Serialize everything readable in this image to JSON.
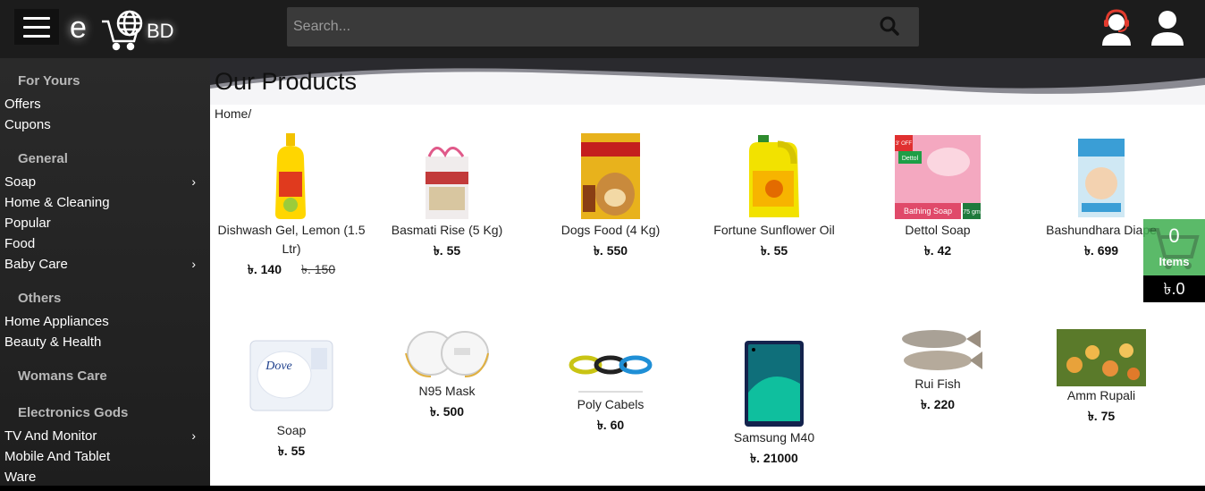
{
  "header": {
    "logo_letter": "e",
    "logo_suffix": "BD",
    "search_placeholder": "Search...",
    "icons": [
      "menu-icon",
      "search-icon",
      "support-icon",
      "user-icon"
    ]
  },
  "sidebar": {
    "sections": [
      {
        "title": "For Yours",
        "items": [
          {
            "label": "Offers",
            "chevron": false
          },
          {
            "label": "Cupons",
            "chevron": false
          }
        ]
      },
      {
        "title": "General",
        "items": [
          {
            "label": "Soap",
            "chevron": true
          },
          {
            "label": "Home & Cleaning",
            "chevron": false
          },
          {
            "label": "Popular",
            "chevron": false
          },
          {
            "label": "Food",
            "chevron": false
          },
          {
            "label": "Baby Care",
            "chevron": true
          }
        ]
      },
      {
        "title": "Others",
        "items": [
          {
            "label": "Home Appliances",
            "chevron": false
          },
          {
            "label": "Beauty & Health",
            "chevron": false
          }
        ]
      },
      {
        "title": "Womans Care",
        "items": []
      },
      {
        "title": "Electronics Gods",
        "items": [
          {
            "label": "TV And Monitor",
            "chevron": true
          },
          {
            "label": "Mobile And Tablet",
            "chevron": false
          },
          {
            "label": "Ware",
            "chevron": false
          }
        ]
      }
    ]
  },
  "main": {
    "title": "Our Products",
    "breadcrumb": "Home/"
  },
  "products": [
    {
      "name": "Dishwash Gel, Lemon (1.5 Ltr)",
      "price": "৳. 140",
      "old_price": "৳. 150"
    },
    {
      "name": "Basmati Rise (5 Kg)",
      "price": "৳. 55"
    },
    {
      "name": "Dogs Food (4 Kg)",
      "price": "৳. 550"
    },
    {
      "name": "Fortune Sunflower Oil",
      "price": "৳. 55"
    },
    {
      "name": "Dettol Soap",
      "price": "৳. 42",
      "image_text": [
        "3' OFF",
        "Dettol",
        "Bathing Soap",
        "75 gm"
      ]
    },
    {
      "name": "Bashundhara Diape",
      "price": "৳. 699"
    },
    {
      "name": "Soap",
      "price": "৳. 55",
      "image_text": [
        "Dove"
      ]
    },
    {
      "name": "N95 Mask",
      "price": "৳. 500"
    },
    {
      "name": "Poly Cabels",
      "price": "৳. 60"
    },
    {
      "name": "Samsung M40",
      "price": "৳. 21000"
    },
    {
      "name": "Rui Fish",
      "price": "৳. 220"
    },
    {
      "name": "Amm Rupali",
      "price": "৳. 75"
    }
  ],
  "cart": {
    "count": "0",
    "label": "Items",
    "total": "৳.0"
  },
  "colors": {
    "topbar": "#1c1c1c",
    "sidebar": "#262626",
    "cart_green": "#3fae4f",
    "main_bg": "#ffffff"
  }
}
